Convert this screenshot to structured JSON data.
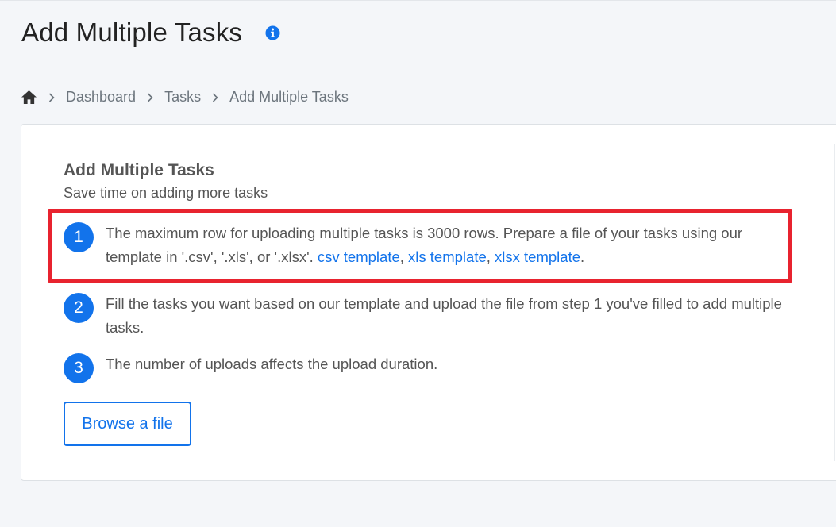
{
  "page": {
    "title": "Add Multiple Tasks",
    "info_icon": "info-circle-icon"
  },
  "breadcrumb": {
    "home_icon": "home-icon",
    "items": [
      "Dashboard",
      "Tasks",
      "Add Multiple Tasks"
    ]
  },
  "card": {
    "heading": "Add Multiple Tasks",
    "subtitle": "Save time on adding more tasks",
    "steps": [
      {
        "num": "1",
        "text": "The maximum row for uploading multiple tasks is 3000 rows. Prepare a file of your tasks using our template in '.csv', '.xls', or '.xlsx'.",
        "links": [
          "csv template",
          "xls template",
          "xlsx template"
        ],
        "separator": ",",
        "end": "."
      },
      {
        "num": "2",
        "text": "Fill the tasks you want based on our template and upload the file from step 1 you've filled to add multiple tasks."
      },
      {
        "num": "3",
        "text": "The number of uploads affects the upload duration."
      }
    ],
    "browse_label": "Browse a file"
  },
  "colors": {
    "accent": "#1273eb",
    "highlight": "#e8232f",
    "background": "#f4f6f9"
  }
}
